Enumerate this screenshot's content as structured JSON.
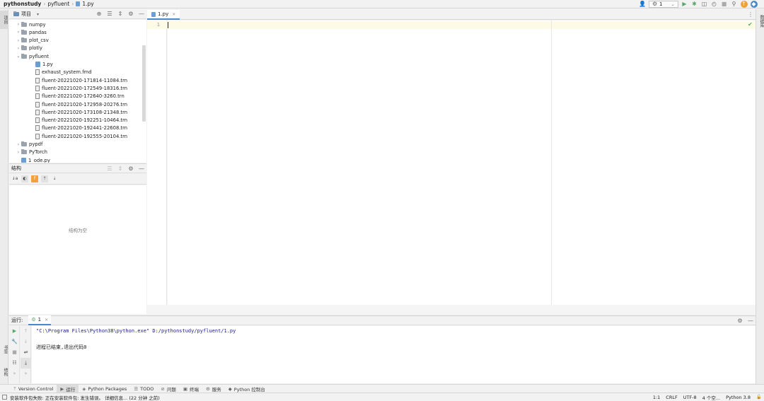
{
  "breadcrumb": {
    "project": "pythonstudy",
    "folder": "pyfluent",
    "file": "1.py"
  },
  "toolbar": {
    "run_config": "1"
  },
  "left_strip": {
    "project_tab": "项目",
    "bookmark_tab": "书签",
    "structure_tab": "结构"
  },
  "right_strip": {
    "db_tab": "数据库"
  },
  "project_panel": {
    "title": "项目",
    "tree": [
      {
        "label": "numpy",
        "kind": "folder",
        "depth": 1,
        "chevron": "›"
      },
      {
        "label": "pandas",
        "kind": "folder",
        "depth": 1,
        "chevron": "›"
      },
      {
        "label": "plot_csv",
        "kind": "folder",
        "depth": 1,
        "chevron": "›"
      },
      {
        "label": "plotly",
        "kind": "folder",
        "depth": 1,
        "chevron": "›"
      },
      {
        "label": "pyfluent",
        "kind": "folder",
        "depth": 1,
        "chevron": "⌄"
      },
      {
        "label": "1.py",
        "kind": "py",
        "depth": 2,
        "chevron": ""
      },
      {
        "label": "exhaust_system.fmd",
        "kind": "file",
        "depth": 2,
        "chevron": ""
      },
      {
        "label": "fluent-20221020-171814-11084.trn",
        "kind": "file",
        "depth": 2,
        "chevron": ""
      },
      {
        "label": "fluent-20221020-172549-18316.trn",
        "kind": "file",
        "depth": 2,
        "chevron": ""
      },
      {
        "label": "fluent-20221020-172640-3260.trn",
        "kind": "file",
        "depth": 2,
        "chevron": ""
      },
      {
        "label": "fluent-20221020-172958-20276.trn",
        "kind": "file",
        "depth": 2,
        "chevron": ""
      },
      {
        "label": "fluent-20221020-173108-21348.trn",
        "kind": "file",
        "depth": 2,
        "chevron": ""
      },
      {
        "label": "fluent-20221020-192251-10464.trn",
        "kind": "file",
        "depth": 2,
        "chevron": ""
      },
      {
        "label": "fluent-20221020-192441-22608.trn",
        "kind": "file",
        "depth": 2,
        "chevron": ""
      },
      {
        "label": "fluent-20221020-192555-20104.trn",
        "kind": "file",
        "depth": 2,
        "chevron": ""
      },
      {
        "label": "pypdf",
        "kind": "folder",
        "depth": 1,
        "chevron": "›"
      },
      {
        "label": "PyTorch",
        "kind": "folder",
        "depth": 1,
        "chevron": "›"
      },
      {
        "label": "1_ode.py",
        "kind": "py",
        "depth": 1,
        "chevron": ""
      }
    ]
  },
  "structure_panel": {
    "title": "结构",
    "empty_text": "结构为空"
  },
  "editor": {
    "tab_label": "1.py",
    "line_number": "1"
  },
  "run_panel": {
    "title": "运行:",
    "tab_label": "1",
    "lines": [
      "\"C:\\Program Files\\Python38\\python.exe\" D:/pythonstudy/pyfluent/1.py",
      "",
      "进程已结束,退出代码0"
    ]
  },
  "bottom_tabs": [
    {
      "label": "Version Control",
      "icon": "version-control-icon"
    },
    {
      "label": "运行",
      "icon": "run-icon"
    },
    {
      "label": "Python Packages",
      "icon": "packages-icon"
    },
    {
      "label": "TODO",
      "icon": "todo-icon"
    },
    {
      "label": "问题",
      "icon": "problems-icon"
    },
    {
      "label": "终端",
      "icon": "terminal-icon"
    },
    {
      "label": "服务",
      "icon": "services-icon"
    },
    {
      "label": "Python 控制台",
      "icon": "python-console-icon"
    }
  ],
  "status": {
    "message": "安装软件包失败: 正在安装软件包: 发生错误。 详细信息... (22 分钟 之前)",
    "position": "1:1",
    "line_sep": "CRLF",
    "encoding": "UTF-8",
    "indent": "4 个空...",
    "interpreter": "Python 3.8"
  },
  "colors": {
    "accent": "#4a88c7",
    "current_line": "#fdfbe5",
    "run_green": "#59a869"
  }
}
